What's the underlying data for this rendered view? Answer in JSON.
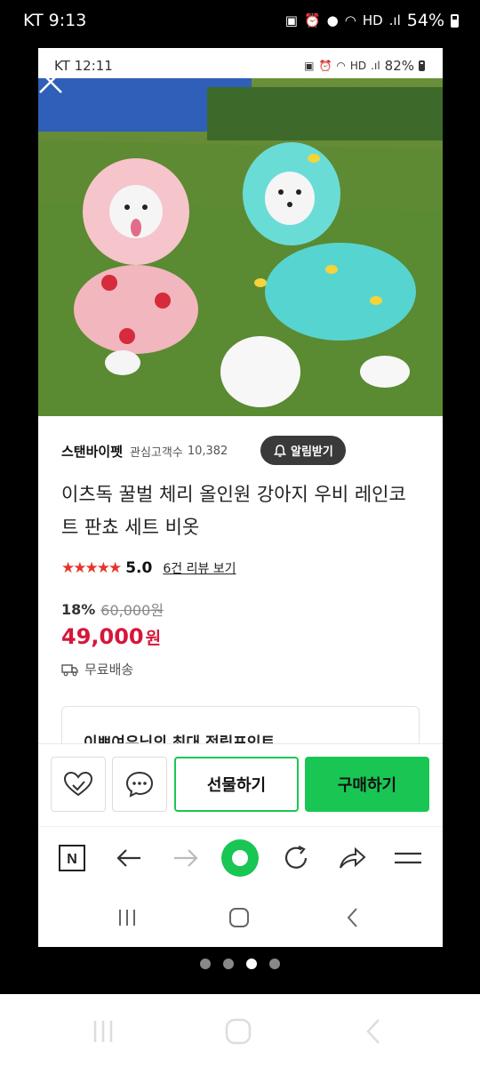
{
  "outer_status": {
    "carrier_time": "KT 9:13",
    "battery": "54%",
    "icons": [
      "nfc-icon",
      "alarm-icon",
      "location-icon",
      "wifi-icon",
      "hd-icon",
      "signal-icon"
    ]
  },
  "inner_status": {
    "carrier_time": "KT 12:11",
    "battery": "82%",
    "icons": [
      "nfc-icon",
      "alarm-icon",
      "wifi-icon",
      "hd-icon",
      "signal-icon"
    ]
  },
  "gallery": {
    "page_count": 4,
    "active_index": 1
  },
  "store": {
    "name": "스탠바이펫",
    "followers_label": "관심고객수",
    "followers_count": "10,382",
    "alert_button": "알림받기"
  },
  "product": {
    "title": "이츠독 꿀벌 체리 올인원 강아지 우비 레인코트 판쵸 세트 비옷",
    "rating": "5.0",
    "review_link": "6건 리뷰 보기",
    "discount": "18%",
    "original_price": "60,000원",
    "price": "49,000",
    "price_unit": "원",
    "shipping": "무료배송",
    "point_banner": "이쁘여우님의 최대 적립포인트"
  },
  "actions": {
    "gift": "선물하기",
    "buy": "구매하기"
  },
  "browser_toolbar": [
    "naver-icon",
    "back-arrow-icon",
    "forward-arrow-icon",
    "home-green-icon",
    "refresh-icon",
    "share-icon",
    "menu-icon"
  ],
  "outer_pager": {
    "page_count": 4,
    "active_index": 2
  },
  "colors": {
    "accent_green": "#19c653",
    "price_red": "#d6163b",
    "star_red": "#e5352b"
  }
}
